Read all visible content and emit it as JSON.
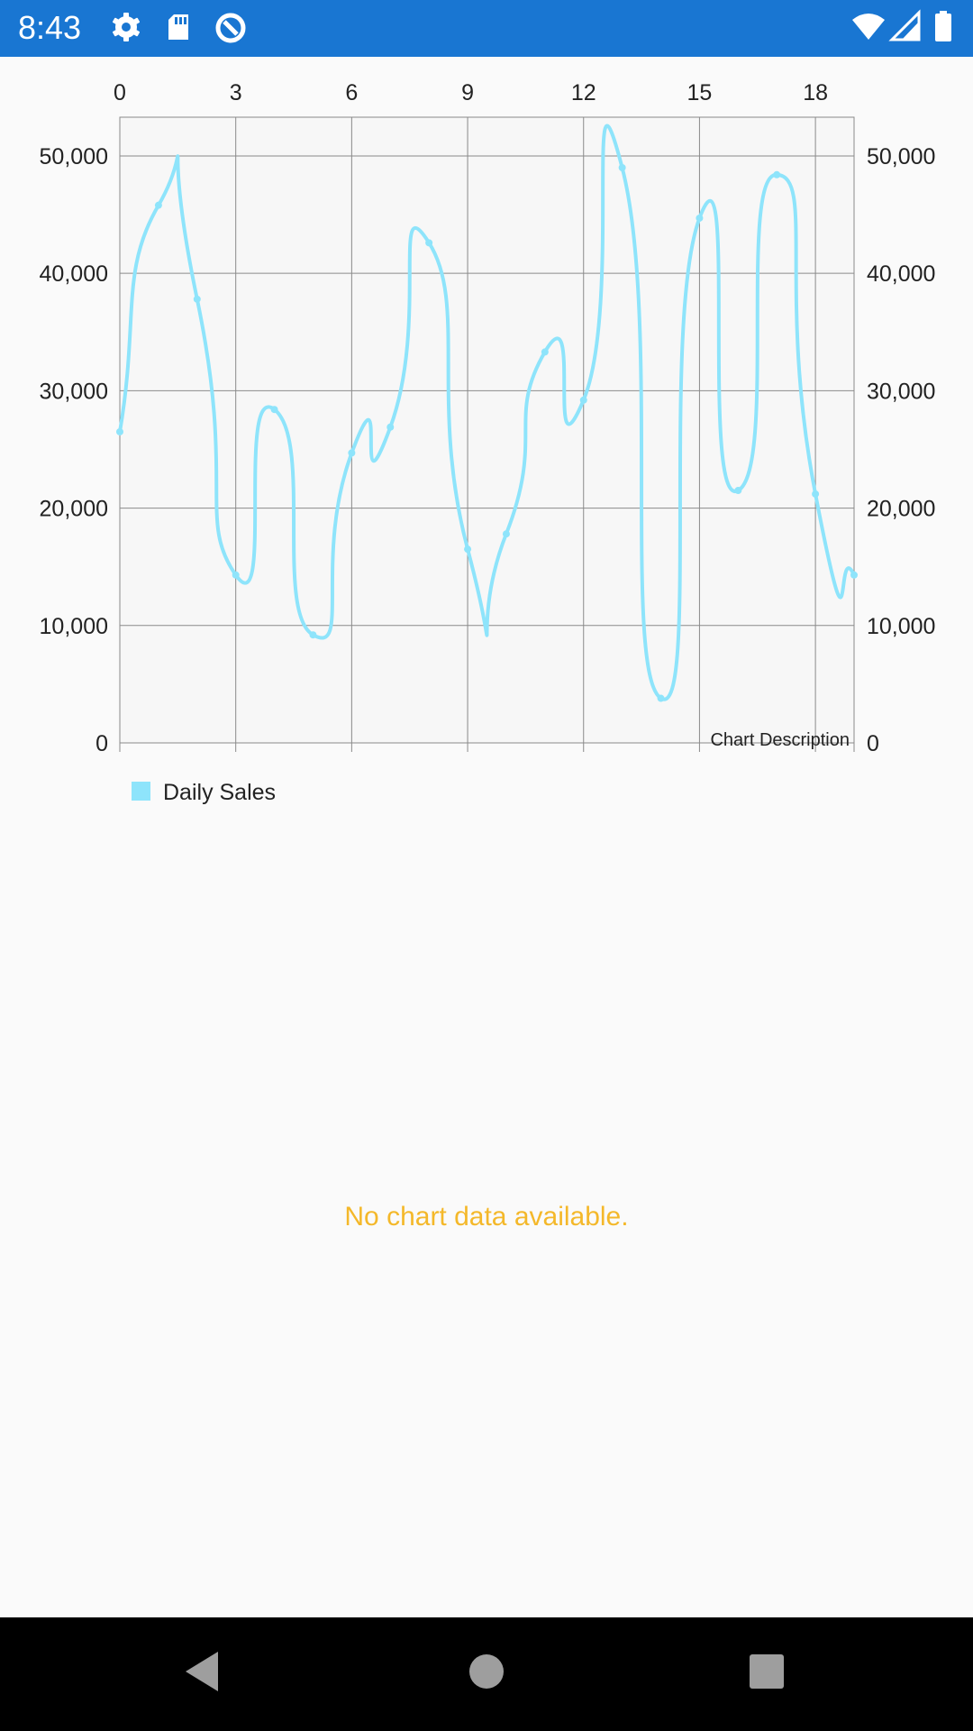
{
  "status_bar": {
    "time": "8:43",
    "background": "#1976d2",
    "icons_left": [
      "settings-gear-icon",
      "sd-card-icon",
      "no-disturb-icon"
    ],
    "icons_right": [
      "wifi-icon",
      "cellular-signal-icon",
      "battery-icon"
    ]
  },
  "legend": {
    "label": "Daily Sales",
    "color": "#8ee4fb"
  },
  "no_data_message": {
    "text": "No chart data available.",
    "color": "#f4b82a"
  },
  "nav_bar": {
    "buttons": [
      "back-icon",
      "home-icon",
      "overview-icon"
    ]
  },
  "chart_data": {
    "type": "line",
    "description": "Chart Description",
    "line_color": "#8ee4fb",
    "smoothing": "cubic",
    "grid": true,
    "x_axis": {
      "position": "top",
      "ticks": [
        "0",
        "3",
        "6",
        "9",
        "12",
        "15",
        "18"
      ],
      "range": [
        0,
        19
      ]
    },
    "y_axis_left": {
      "ticks": [
        "0",
        "10,000",
        "20,000",
        "30,000",
        "40,000",
        "50,000"
      ],
      "range": [
        0,
        53300
      ]
    },
    "y_axis_right": {
      "ticks": [
        "0",
        "10,000",
        "20,000",
        "30,000",
        "40,000",
        "50,000"
      ],
      "range": [
        0,
        53300
      ]
    },
    "series": [
      {
        "name": "Daily Sales",
        "x": [
          0,
          1,
          2,
          3,
          4,
          5,
          6,
          7,
          8,
          9,
          10,
          11,
          12,
          13,
          14,
          15,
          16,
          17,
          18,
          19
        ],
        "values": [
          26500,
          45800,
          37800,
          14300,
          28400,
          9200,
          24700,
          26900,
          42600,
          16500,
          17800,
          33300,
          29200,
          49000,
          3800,
          44700,
          21500,
          48400,
          21200,
          14300
        ]
      }
    ]
  }
}
